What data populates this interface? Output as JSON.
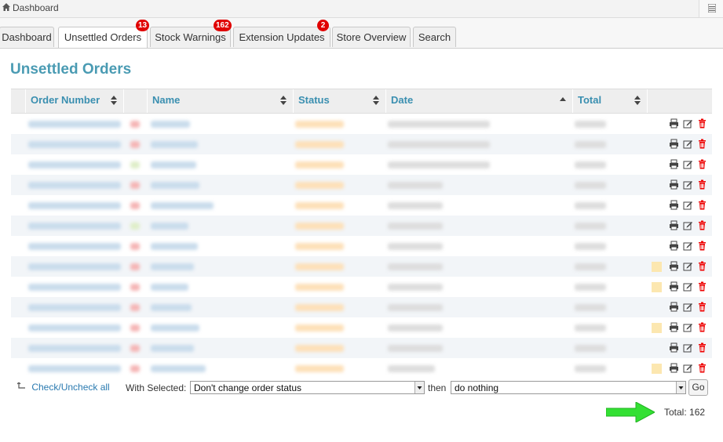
{
  "topbar": {
    "title": "Dashboard"
  },
  "tabs": [
    {
      "label": "Dashboard",
      "badge": ""
    },
    {
      "label": "Unsettled Orders",
      "badge": "13"
    },
    {
      "label": "Stock Warnings",
      "badge": "162"
    },
    {
      "label": "Extension Updates",
      "badge": "2"
    },
    {
      "label": "Store Overview",
      "badge": ""
    },
    {
      "label": "Search",
      "badge": ""
    }
  ],
  "page_title": "Unsettled Orders",
  "table": {
    "headers": [
      "Order Number",
      "Name",
      "Status",
      "Date",
      "Total"
    ],
    "rows": 13,
    "rows_with_notes": [
      7,
      8,
      10,
      12
    ]
  },
  "footer": {
    "check_all": "Check/Uncheck all",
    "with_selected": "With Selected:",
    "status_select": "Don't change order status",
    "then": "then",
    "action_select": "do nothing",
    "go": "Go",
    "total": "Total: 162"
  },
  "colors": {
    "accent": "#4a9bb3",
    "badge": "#e00000",
    "arrow": "#2ee02e"
  }
}
